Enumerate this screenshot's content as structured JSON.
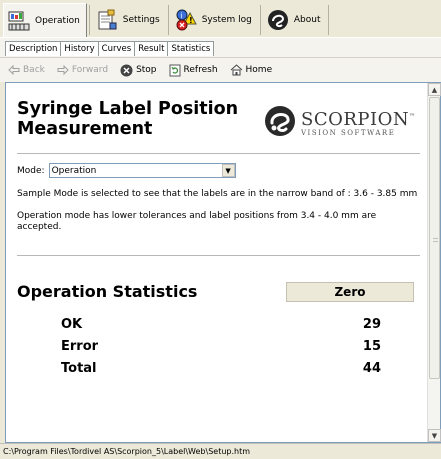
{
  "toolbar": {
    "tabs": [
      {
        "label": "Operation",
        "icon": "operation-icon"
      },
      {
        "label": "Settings",
        "icon": "settings-icon"
      },
      {
        "label": "System log",
        "icon": "system-log-icon"
      },
      {
        "label": "About",
        "icon": "about-icon"
      }
    ]
  },
  "subtabs": [
    "Description",
    "History",
    "Curves",
    "Result",
    "Statistics"
  ],
  "nav": {
    "back": "Back",
    "forward": "Forward",
    "stop": "Stop",
    "refresh": "Refresh",
    "home": "Home"
  },
  "page": {
    "title": "Syringe Label Position Measurement",
    "logo": {
      "name": "SCORPION",
      "tm": "™",
      "sub": "VISION SOFTWARE"
    },
    "mode_label": "Mode:",
    "mode_value": "Operation",
    "para1": "Sample Mode is selected to see that the labels are in the narrow band of : 3.6 - 3.85 mm",
    "para2": "Operation mode has lower tolerances and label positions from 3.4 - 4.0 mm are accepted.",
    "stats_title": "Operation Statistics",
    "zero_label": "Zero",
    "stats": [
      {
        "label": "OK",
        "value": "29"
      },
      {
        "label": "Error",
        "value": "15"
      },
      {
        "label": "Total",
        "value": "44"
      }
    ]
  },
  "status_path": "C:\\Program Files\\Tordivel AS\\Scorpion_5\\Label\\Web\\Setup.htm",
  "colors": {
    "window_bg": "#ece9d8",
    "border": "#7f9db9"
  }
}
